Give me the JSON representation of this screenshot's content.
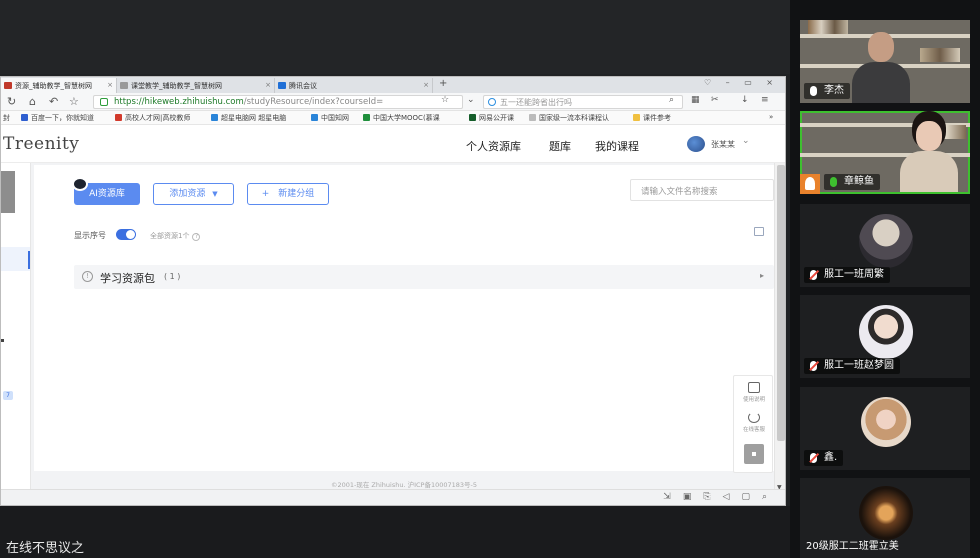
{
  "browser": {
    "tabs": [
      {
        "label": "资源_辅助教学_智慧树网",
        "color": "#c0392b"
      },
      {
        "label": "课堂教学_辅助教学_智慧树网",
        "color": "#888888"
      },
      {
        "label": "腾讯会议",
        "color": "#1f6fd6"
      }
    ],
    "url_host": "https://hikeweb.zhihuishu.com",
    "url_path": "/studyResource/index?courseId=",
    "search_placeholder": "五一还能跨省出行吗",
    "bookmarks": [
      "百度一下，你就知道",
      "高校人才网|高校教师",
      "超星电脑网 超星电脑",
      "中国知网",
      "中国大学MOOC(慕课",
      "网易公开课",
      "国家级一流本科课程认",
      "课件参考"
    ],
    "bookmark_prefix": "封"
  },
  "site": {
    "logo": "Treenity",
    "nav": [
      "个人资源库",
      "题库",
      "我的课程"
    ],
    "username": "张某某",
    "buttons": {
      "ai": "AI资源库",
      "add": "添加资源",
      "add_caret": "▼",
      "new_group_plus": "+",
      "new_group": "新建分组"
    },
    "file_search_placeholder": "请输入文件名称搜索",
    "show_serial": "显示序号",
    "resource_total": "全部资源1个",
    "package": {
      "title": "学习资源包",
      "count": "( 1 )"
    },
    "float": [
      "使用说明",
      "在线客服"
    ],
    "footer": "©2001-现在 Zhihuishu. 沪ICP备10007183号-5",
    "badge": "7"
  },
  "participants": [
    {
      "name": "李杰",
      "mic": "on"
    },
    {
      "name": "章鲸鱼",
      "mic": "speaking",
      "host": true
    },
    {
      "name": "服工一班周繁",
      "mic": "muted"
    },
    {
      "name": "服工一班赵梦圆",
      "mic": "muted"
    },
    {
      "name": "鑫.",
      "mic": "muted"
    },
    {
      "name": "20级服工二班霍立美",
      "mic": "none"
    }
  ],
  "caption": "在线不思议之"
}
